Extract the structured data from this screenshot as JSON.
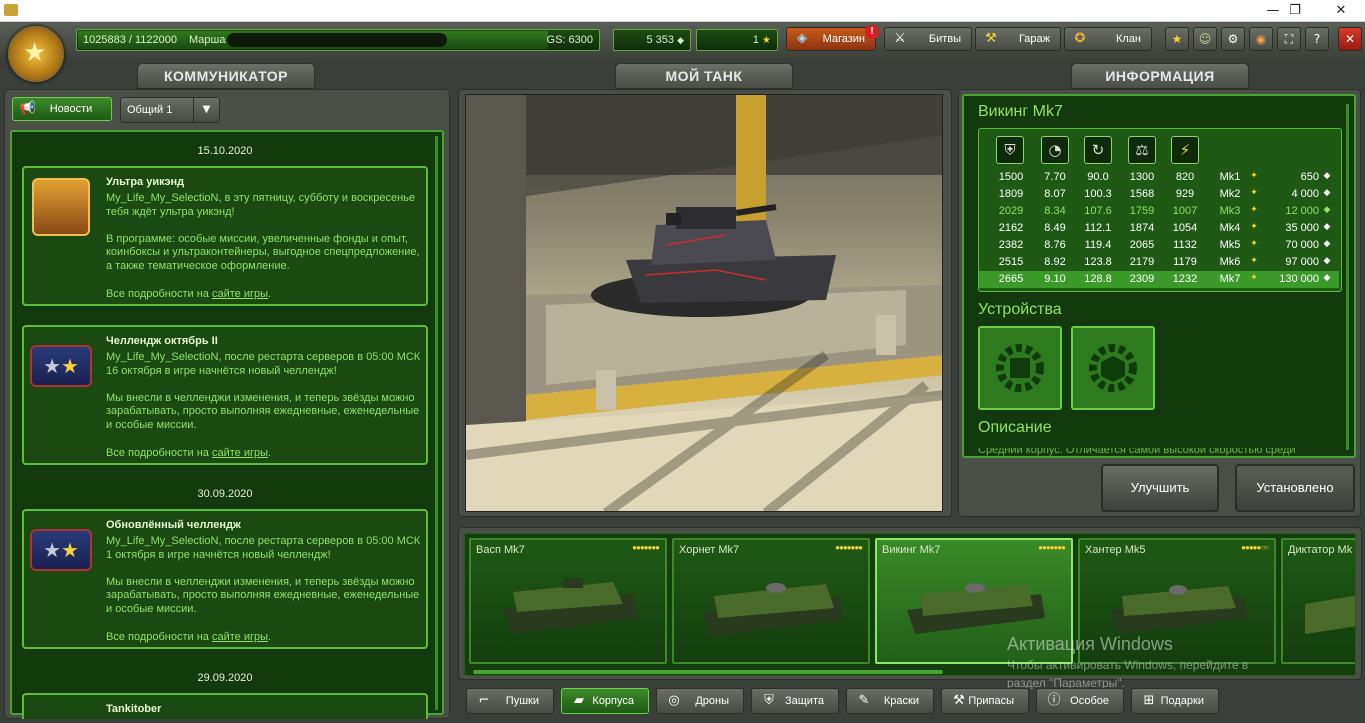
{
  "window": {
    "min": "—",
    "restore": "❐",
    "close": "✕"
  },
  "topbar": {
    "exp": "1025883 / 1122000",
    "rank_name": "Марша",
    "gs": "GS: 6300",
    "crystals": "5 353",
    "stars": "1",
    "nav": [
      {
        "label": "Магазин",
        "icon": "gem-icon"
      },
      {
        "label": "Битвы",
        "icon": "crossed-swords-icon"
      },
      {
        "label": "Гараж",
        "icon": "wrench-icon"
      },
      {
        "label": "Клан",
        "icon": "medal-icon"
      }
    ],
    "shop_alert": "!",
    "icons": [
      "star-icon",
      "friends-icon",
      "settings-icon",
      "sound-icon",
      "fullscreen-icon",
      "help-icon",
      "close-icon"
    ]
  },
  "left": {
    "title": "КОММУНИКАТОР",
    "news_btn": "Новости",
    "channel": "Общий 1",
    "dates": [
      "15.10.2020",
      "30.09.2020",
      "29.09.2020"
    ],
    "cards": [
      {
        "title": "Ультра уикэнд",
        "body": "My_Life_My_SelectioN, в эту пятницу, субботу и воскресенье тебя ждёт ультра уикэнд!\n\nВ программе: особые миссии, увеличенные фонды и опыт, коинбоксы и ультраконтейнеры, выгодное спецпредложение, а также тематическое оформление.",
        "more": "Все подробности на",
        "link": "сайте игры",
        "dot": "."
      },
      {
        "title": "Челлендж октябрь II",
        "body": "My_Life_My_SelectioN, после рестарта серверов в 05:00 МСК 16 октября в игре начнётся новый челлендж!\n\nМы внесли в челленджи изменения, и теперь звёзды можно зарабатывать, просто выполняя ежедневные, еженедельные и особые миссии.",
        "more": "Все подробности на",
        "link": "сайте игры",
        "dot": "."
      },
      {
        "title": "Обновлённый челлендж",
        "body": "My_Life_My_SelectioN, после рестарта серверов в 05:00 МСК 1 октября в игре начнётся новый челлендж!\n\nМы внесли в челленджи изменения, и теперь звёзды можно зарабатывать, просто выполняя ежедневные, еженедельные и особые миссии.",
        "more": "Все подробности на",
        "link": "сайте игры",
        "dot": "."
      },
      {
        "title": "Tankitober"
      }
    ]
  },
  "center": {
    "title": "МОЙ ТАНК"
  },
  "right": {
    "title": "ИНФОРМАЦИЯ",
    "tank_name": "Викинг Mk7",
    "stat_icons": [
      "armor-icon",
      "speed-icon",
      "turn-icon",
      "weight-icon",
      "power-icon"
    ],
    "rows": [
      {
        "v": [
          "1500",
          "7.70",
          "90.0",
          "1300",
          "820"
        ],
        "mk": "Mk1",
        "price": "650"
      },
      {
        "v": [
          "1809",
          "8.07",
          "100.3",
          "1568",
          "929"
        ],
        "mk": "Mk2",
        "price": "4 000"
      },
      {
        "v": [
          "2029",
          "8.34",
          "107.6",
          "1759",
          "1007"
        ],
        "mk": "Mk3",
        "price": "12 000"
      },
      {
        "v": [
          "2162",
          "8.49",
          "112.1",
          "1874",
          "1054"
        ],
        "mk": "Mk4",
        "price": "35 000"
      },
      {
        "v": [
          "2382",
          "8.76",
          "119.4",
          "2065",
          "1132"
        ],
        "mk": "Mk5",
        "price": "70 000"
      },
      {
        "v": [
          "2515",
          "8.92",
          "123.8",
          "2179",
          "1179"
        ],
        "mk": "Mk6",
        "price": "97 000"
      },
      {
        "v": [
          "2665",
          "9.10",
          "128.8",
          "2309",
          "1232"
        ],
        "mk": "Mk7",
        "price": "130 000"
      }
    ],
    "devices": "Устройства",
    "description": "Описание",
    "desc_text": "Средний корпус. Отличается самой высокой скоростью среди",
    "upgrade": "Улучшить",
    "installed": "Установлено"
  },
  "hulls": [
    {
      "name": "Васп Mk7",
      "dots": "●●●●●●●"
    },
    {
      "name": "Хорнет Mk7",
      "dots": "●●●●●●●"
    },
    {
      "name": "Викинг Mk7",
      "dots": "●●●●●●●"
    },
    {
      "name": "Хантер Mk5",
      "dots": "●●●●●○○"
    },
    {
      "name": "Диктатор Mk",
      "dots": ""
    }
  ],
  "tabs": [
    {
      "label": "Пушки",
      "icon": "cannon-icon"
    },
    {
      "label": "Корпуса",
      "icon": "hull-icon"
    },
    {
      "label": "Дроны",
      "icon": "drone-icon"
    },
    {
      "label": "Защита",
      "icon": "shield-icon"
    },
    {
      "label": "Краски",
      "icon": "paint-icon"
    },
    {
      "label": "Припасы",
      "icon": "supplies-icon"
    },
    {
      "label": "Особое",
      "icon": "special-icon"
    },
    {
      "label": "Подарки",
      "icon": "gift-icon"
    }
  ],
  "watermark": {
    "line1": "Активация Windows",
    "line2": "Чтобы активировать Windows, перейдите в",
    "line3": "раздел \"Параметры\"."
  },
  "colors": {
    "accent_green": "#5cbf3a",
    "panel_dark": "#123a0c",
    "selected_row": "#3c9a2a"
  }
}
